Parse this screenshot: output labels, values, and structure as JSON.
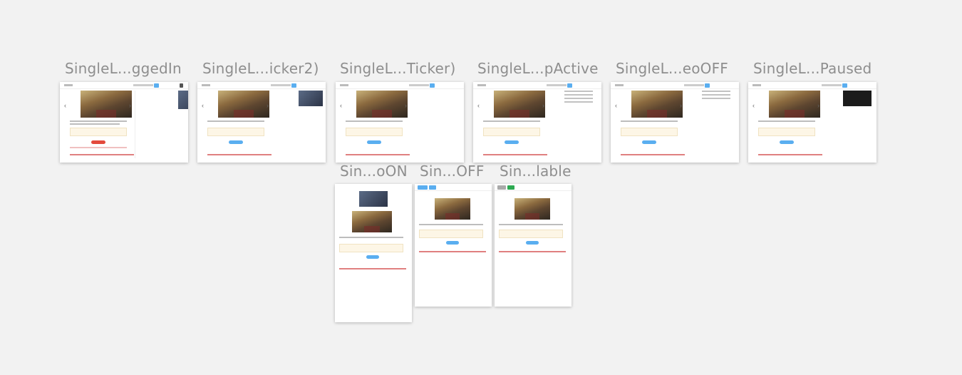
{
  "boards": [
    {
      "id": "b1",
      "label": "SingleL...ggedIn",
      "variant": "loggedIn"
    },
    {
      "id": "b2",
      "label": "SingleL...icker2)",
      "variant": "ticker2"
    },
    {
      "id": "b3",
      "label": "SingleL...Ticker)",
      "variant": "ticker"
    },
    {
      "id": "b4",
      "label": "SingleL...pActive",
      "variant": "active"
    },
    {
      "id": "b5",
      "label": "SingleL...eoOFF",
      "variant": "videoOff"
    },
    {
      "id": "b6",
      "label": "SingleL...Paused",
      "variant": "paused"
    },
    {
      "id": "b7",
      "label": "Sin...oON",
      "variant": "videoOnMobile"
    },
    {
      "id": "b8",
      "label": "Sin...OFF",
      "variant": "offMobile"
    },
    {
      "id": "b9",
      "label": "Sin...lable",
      "variant": "availableMobile"
    }
  ],
  "colors": {
    "background": "#f2f2f2",
    "label": "#8e8e8e",
    "accent_blue": "#5aaef0",
    "accent_green": "#2daa52",
    "accent_red": "#e34a3d"
  }
}
